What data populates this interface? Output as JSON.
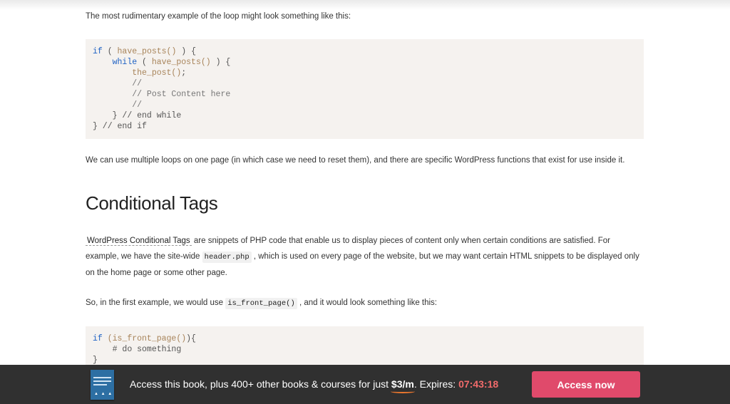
{
  "article": {
    "intro": "The most rudimentary example of the loop might look something like this:",
    "code1": {
      "l1_kw": "if",
      "l1_rest": " ( ",
      "l1_fn": "have_posts()",
      "l1_end": " ) {",
      "l2_kw": "while",
      "l2_rest": " ( ",
      "l2_fn": "have_posts()",
      "l2_end": " ) {",
      "l3_fn": "the_post()",
      "l3_end": ";",
      "l4": "//",
      "l5": "// Post Content here",
      "l6": "//",
      "l7": "} // end while",
      "l8": "} // end if"
    },
    "multi_loops": "We can use multiple loops on one page (in which case we need to reset them), and there are specific WordPress functions that exist for use inside it.",
    "heading": "Conditional Tags",
    "para1": {
      "link": "WordPress Conditional Tags",
      "text1": " are snippets of PHP code that enable us to display pieces of content only when certain conditions are satisfied. For example, we have the site-wide ",
      "code": "header.php",
      "text2": " , which is used on every page of the website, but we may want certain HTML snippets to be displayed only on the home page or some other page."
    },
    "para2": {
      "text1": "So, in the first example, we would use ",
      "code": "is_front_page()",
      "text2": " , and it would look something like this:"
    },
    "code2": {
      "l1_kw": "if",
      "l1_fn": " (is_front_page()",
      "l1_end": "){",
      "l2": "# do something",
      "l3": "}"
    }
  },
  "banner": {
    "text_before": "Access this book, plus 400+ other books & courses for just ",
    "price": "$3/m",
    "text_mid": ". Expires: ",
    "timer": "07:43:18",
    "button": "Access now",
    "book_dots": "▲ ▲ ▲"
  }
}
